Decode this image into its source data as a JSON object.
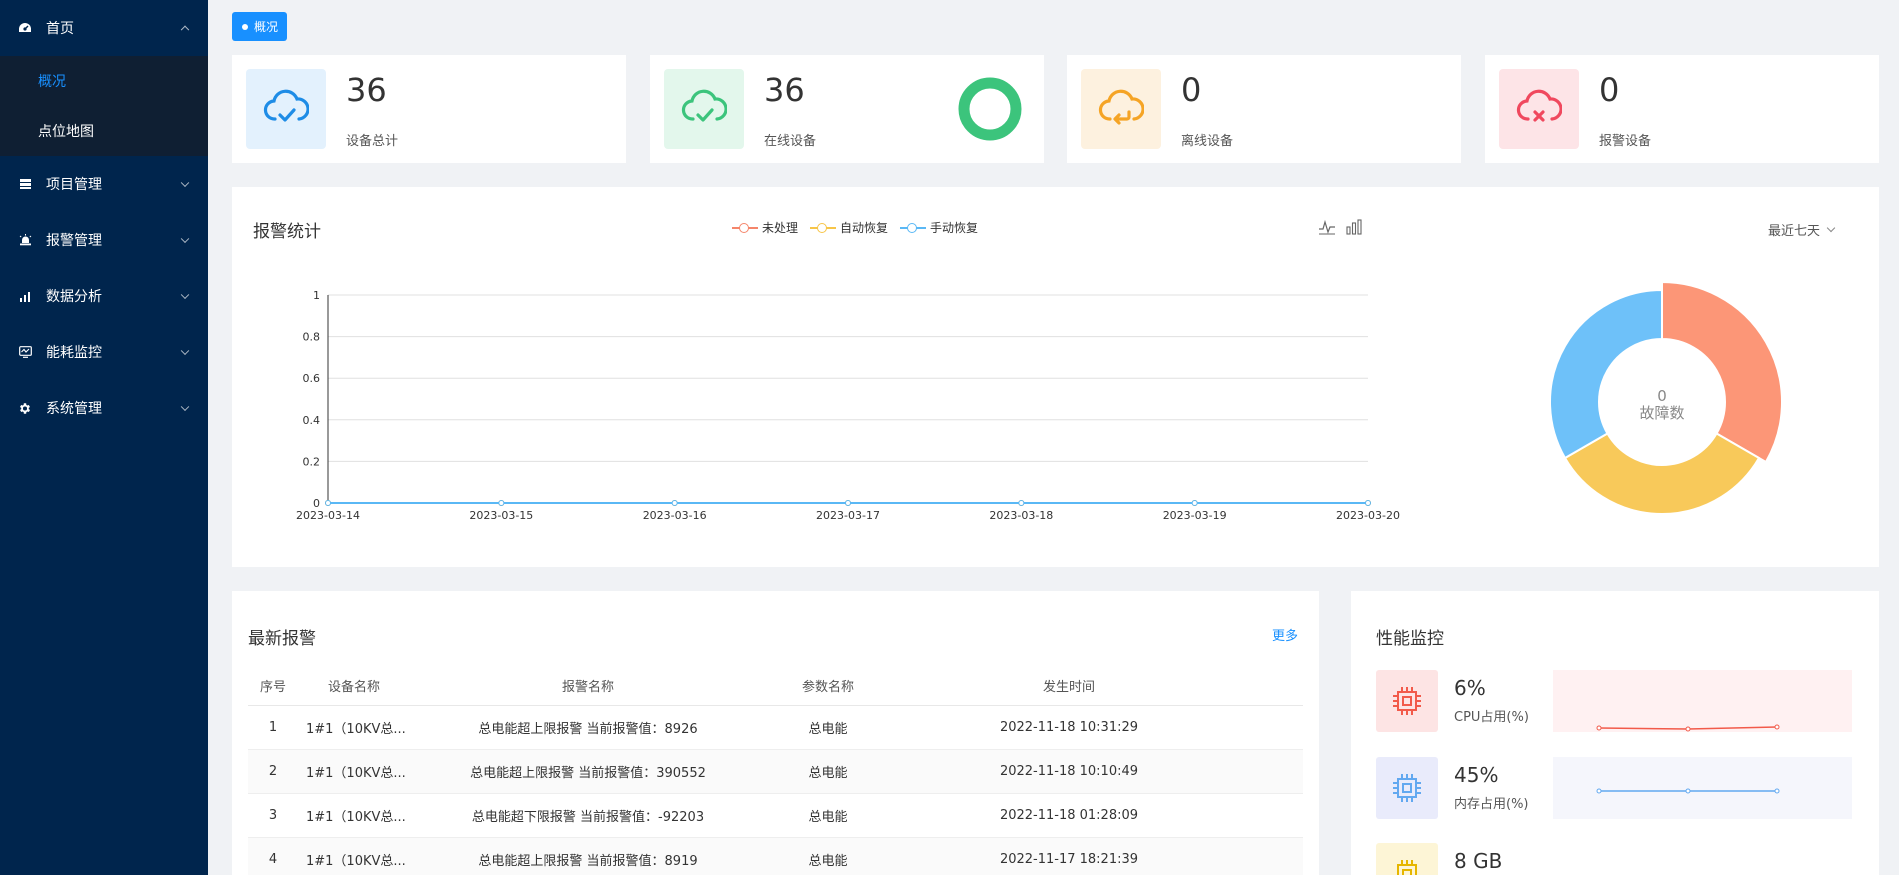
{
  "sidebar": {
    "menu": [
      {
        "label": "首页",
        "icon": "dashboard-icon",
        "expanded": true,
        "children": [
          {
            "label": "概况",
            "active": true
          },
          {
            "label": "点位地图",
            "active": false
          }
        ]
      },
      {
        "label": "项目管理",
        "icon": "project-icon"
      },
      {
        "label": "报警管理",
        "icon": "alarm-icon"
      },
      {
        "label": "数据分析",
        "icon": "bar-chart-icon"
      },
      {
        "label": "能耗监控",
        "icon": "energy-monitor-icon"
      },
      {
        "label": "系统管理",
        "icon": "gear-icon"
      }
    ]
  },
  "tag": {
    "label": "概况"
  },
  "stats": [
    {
      "value": "36",
      "label": "设备总计",
      "color": "#1e8ce6",
      "bg": "#e3f1fd"
    },
    {
      "value": "36",
      "label": "在线设备",
      "color": "#3cc47c",
      "bg": "#e3f7ec"
    },
    {
      "value": "0",
      "label": "离线设备",
      "color": "#f5a425",
      "bg": "#fdf1df"
    },
    {
      "value": "0",
      "label": "报警设备",
      "color": "#f0485e",
      "bg": "#fde4e7"
    }
  ],
  "alarm_stats": {
    "title": "报警统计",
    "range": "最近七天",
    "center_value": "0",
    "center_label": "故障数"
  },
  "chart_data": [
    {
      "type": "line",
      "x": [
        "2023-03-14",
        "2023-03-15",
        "2023-03-16",
        "2023-03-17",
        "2023-03-18",
        "2023-03-19",
        "2023-03-20"
      ],
      "series": [
        {
          "name": "未处理",
          "values": [
            0,
            0,
            0,
            0,
            0,
            0,
            0
          ],
          "color": "#f5866b"
        },
        {
          "name": "自动恢复",
          "values": [
            0,
            0,
            0,
            0,
            0,
            0,
            0
          ],
          "color": "#f7c548"
        },
        {
          "name": "手动恢复",
          "values": [
            0,
            0,
            0,
            0,
            0,
            0,
            0
          ],
          "color": "#5ab8f5"
        }
      ],
      "yticks": [
        "0",
        "0.2",
        "0.4",
        "0.6",
        "0.8",
        "1"
      ],
      "ylim": [
        0,
        1
      ],
      "grid": true,
      "legend": "top"
    },
    {
      "type": "pie",
      "donut": true,
      "slices": [
        {
          "value": 1,
          "color": "#fc9677"
        },
        {
          "value": 1,
          "color": "#f8c95a"
        },
        {
          "value": 1,
          "color": "#6ec1f9"
        }
      ]
    }
  ],
  "latest_alarms": {
    "title": "最新报警",
    "more": "更多",
    "columns": [
      "序号",
      "设备名称",
      "报警名称",
      "参数名称",
      "发生时间"
    ],
    "rows": [
      [
        "1",
        "1#1（10KV总...",
        "总电能超上限报警 当前报警值：8926",
        "总电能",
        "2022-11-18 10:31:29"
      ],
      [
        "2",
        "1#1（10KV总...",
        "总电能超上限报警 当前报警值：390552",
        "总电能",
        "2022-11-18 10:10:49"
      ],
      [
        "3",
        "1#1（10KV总...",
        "总电能超下限报警 当前报警值：-92203",
        "总电能",
        "2022-11-18 01:28:09"
      ],
      [
        "4",
        "1#1（10KV总...",
        "总电能超上限报警 当前报警值：8919",
        "总电能",
        "2022-11-17 18:21:39"
      ]
    ]
  },
  "performance": {
    "title": "性能监控",
    "items": [
      {
        "value": "6%",
        "label": "CPU占用(%)",
        "color": "#f25a4a",
        "bg": "#fde4e4",
        "spark_bg": "#fff1f2",
        "level": 0.06
      },
      {
        "value": "45%",
        "label": "内存占用(%)",
        "color": "#62a8f0",
        "bg": "#e9ebfb",
        "spark_bg": "#f5f6fc",
        "level": 0.45
      },
      {
        "value": "8 GB",
        "label": "",
        "color": "#e6b600",
        "bg": "#fdf5d6",
        "spark_bg": "#fffdf3"
      }
    ]
  }
}
